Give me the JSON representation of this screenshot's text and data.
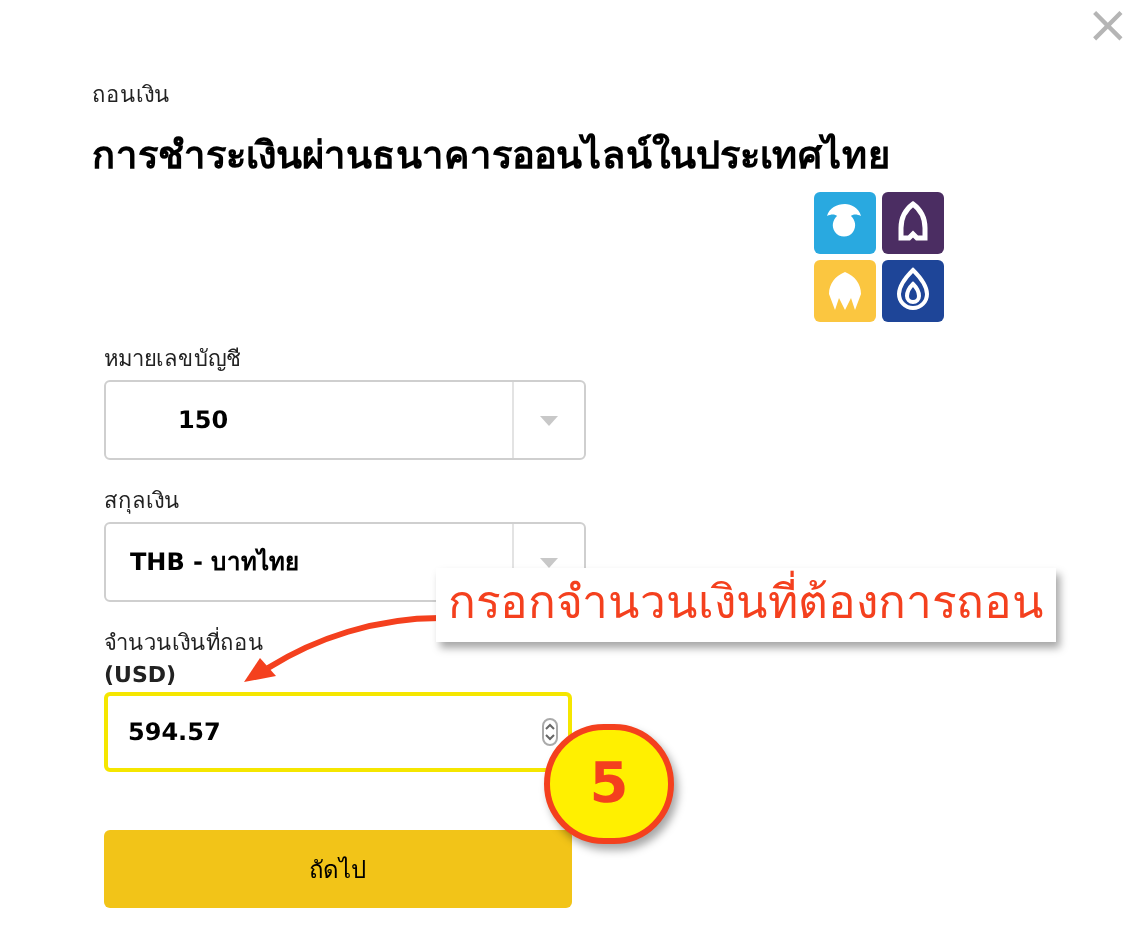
{
  "close": "×",
  "eyebrow": "ถอนเงิน",
  "title": "การชำระเงินผ่านธนาคารออนไลน์ในประเทศไทย",
  "fields": [
    {
      "kind": "select",
      "label": "หมายเลขบัญชี",
      "value": "150",
      "focused": false
    },
    {
      "kind": "select",
      "label": "สกุลเงิน",
      "value": "THB - บาทไทย",
      "focused": false
    },
    {
      "kind": "number",
      "label": "จำนวนเงินที่ถอน",
      "unit": "(USD)",
      "value": "594.57",
      "focused": true
    }
  ],
  "button": "ถัดไป",
  "annotation": {
    "callout": "กรอกจำนวนเงินที่ต้องการถอน",
    "step": "5"
  }
}
